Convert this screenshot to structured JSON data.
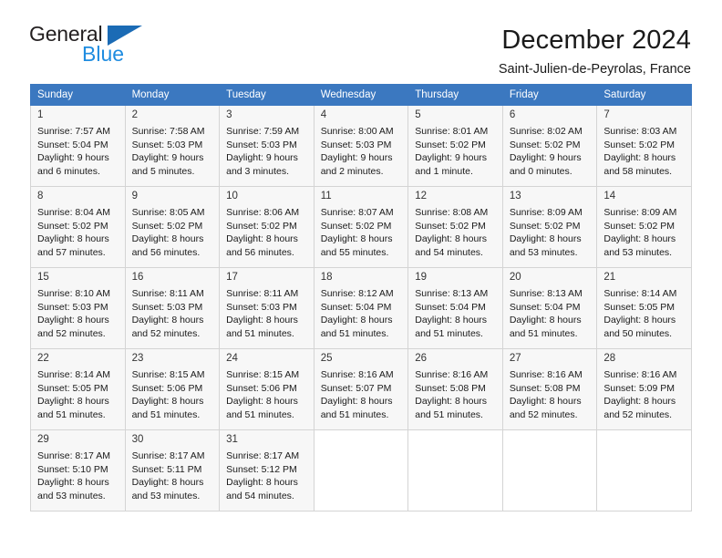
{
  "brand": {
    "name_top": "General",
    "name_bottom": "Blue",
    "accent_color": "#1f8ce0",
    "triangle_color": "#1b6bb5"
  },
  "header": {
    "title": "December 2024",
    "subtitle": "Saint-Julien-de-Peyrolas, France"
  },
  "calendar": {
    "header_bg": "#3b78c0",
    "weekdays": [
      "Sunday",
      "Monday",
      "Tuesday",
      "Wednesday",
      "Thursday",
      "Friday",
      "Saturday"
    ],
    "weeks": [
      [
        {
          "day": "1",
          "sunrise": "Sunrise: 7:57 AM",
          "sunset": "Sunset: 5:04 PM",
          "daylight1": "Daylight: 9 hours",
          "daylight2": "and 6 minutes."
        },
        {
          "day": "2",
          "sunrise": "Sunrise: 7:58 AM",
          "sunset": "Sunset: 5:03 PM",
          "daylight1": "Daylight: 9 hours",
          "daylight2": "and 5 minutes."
        },
        {
          "day": "3",
          "sunrise": "Sunrise: 7:59 AM",
          "sunset": "Sunset: 5:03 PM",
          "daylight1": "Daylight: 9 hours",
          "daylight2": "and 3 minutes."
        },
        {
          "day": "4",
          "sunrise": "Sunrise: 8:00 AM",
          "sunset": "Sunset: 5:03 PM",
          "daylight1": "Daylight: 9 hours",
          "daylight2": "and 2 minutes."
        },
        {
          "day": "5",
          "sunrise": "Sunrise: 8:01 AM",
          "sunset": "Sunset: 5:02 PM",
          "daylight1": "Daylight: 9 hours",
          "daylight2": "and 1 minute."
        },
        {
          "day": "6",
          "sunrise": "Sunrise: 8:02 AM",
          "sunset": "Sunset: 5:02 PM",
          "daylight1": "Daylight: 9 hours",
          "daylight2": "and 0 minutes."
        },
        {
          "day": "7",
          "sunrise": "Sunrise: 8:03 AM",
          "sunset": "Sunset: 5:02 PM",
          "daylight1": "Daylight: 8 hours",
          "daylight2": "and 58 minutes."
        }
      ],
      [
        {
          "day": "8",
          "sunrise": "Sunrise: 8:04 AM",
          "sunset": "Sunset: 5:02 PM",
          "daylight1": "Daylight: 8 hours",
          "daylight2": "and 57 minutes."
        },
        {
          "day": "9",
          "sunrise": "Sunrise: 8:05 AM",
          "sunset": "Sunset: 5:02 PM",
          "daylight1": "Daylight: 8 hours",
          "daylight2": "and 56 minutes."
        },
        {
          "day": "10",
          "sunrise": "Sunrise: 8:06 AM",
          "sunset": "Sunset: 5:02 PM",
          "daylight1": "Daylight: 8 hours",
          "daylight2": "and 56 minutes."
        },
        {
          "day": "11",
          "sunrise": "Sunrise: 8:07 AM",
          "sunset": "Sunset: 5:02 PM",
          "daylight1": "Daylight: 8 hours",
          "daylight2": "and 55 minutes."
        },
        {
          "day": "12",
          "sunrise": "Sunrise: 8:08 AM",
          "sunset": "Sunset: 5:02 PM",
          "daylight1": "Daylight: 8 hours",
          "daylight2": "and 54 minutes."
        },
        {
          "day": "13",
          "sunrise": "Sunrise: 8:09 AM",
          "sunset": "Sunset: 5:02 PM",
          "daylight1": "Daylight: 8 hours",
          "daylight2": "and 53 minutes."
        },
        {
          "day": "14",
          "sunrise": "Sunrise: 8:09 AM",
          "sunset": "Sunset: 5:02 PM",
          "daylight1": "Daylight: 8 hours",
          "daylight2": "and 53 minutes."
        }
      ],
      [
        {
          "day": "15",
          "sunrise": "Sunrise: 8:10 AM",
          "sunset": "Sunset: 5:03 PM",
          "daylight1": "Daylight: 8 hours",
          "daylight2": "and 52 minutes."
        },
        {
          "day": "16",
          "sunrise": "Sunrise: 8:11 AM",
          "sunset": "Sunset: 5:03 PM",
          "daylight1": "Daylight: 8 hours",
          "daylight2": "and 52 minutes."
        },
        {
          "day": "17",
          "sunrise": "Sunrise: 8:11 AM",
          "sunset": "Sunset: 5:03 PM",
          "daylight1": "Daylight: 8 hours",
          "daylight2": "and 51 minutes."
        },
        {
          "day": "18",
          "sunrise": "Sunrise: 8:12 AM",
          "sunset": "Sunset: 5:04 PM",
          "daylight1": "Daylight: 8 hours",
          "daylight2": "and 51 minutes."
        },
        {
          "day": "19",
          "sunrise": "Sunrise: 8:13 AM",
          "sunset": "Sunset: 5:04 PM",
          "daylight1": "Daylight: 8 hours",
          "daylight2": "and 51 minutes."
        },
        {
          "day": "20",
          "sunrise": "Sunrise: 8:13 AM",
          "sunset": "Sunset: 5:04 PM",
          "daylight1": "Daylight: 8 hours",
          "daylight2": "and 51 minutes."
        },
        {
          "day": "21",
          "sunrise": "Sunrise: 8:14 AM",
          "sunset": "Sunset: 5:05 PM",
          "daylight1": "Daylight: 8 hours",
          "daylight2": "and 50 minutes."
        }
      ],
      [
        {
          "day": "22",
          "sunrise": "Sunrise: 8:14 AM",
          "sunset": "Sunset: 5:05 PM",
          "daylight1": "Daylight: 8 hours",
          "daylight2": "and 51 minutes."
        },
        {
          "day": "23",
          "sunrise": "Sunrise: 8:15 AM",
          "sunset": "Sunset: 5:06 PM",
          "daylight1": "Daylight: 8 hours",
          "daylight2": "and 51 minutes."
        },
        {
          "day": "24",
          "sunrise": "Sunrise: 8:15 AM",
          "sunset": "Sunset: 5:06 PM",
          "daylight1": "Daylight: 8 hours",
          "daylight2": "and 51 minutes."
        },
        {
          "day": "25",
          "sunrise": "Sunrise: 8:16 AM",
          "sunset": "Sunset: 5:07 PM",
          "daylight1": "Daylight: 8 hours",
          "daylight2": "and 51 minutes."
        },
        {
          "day": "26",
          "sunrise": "Sunrise: 8:16 AM",
          "sunset": "Sunset: 5:08 PM",
          "daylight1": "Daylight: 8 hours",
          "daylight2": "and 51 minutes."
        },
        {
          "day": "27",
          "sunrise": "Sunrise: 8:16 AM",
          "sunset": "Sunset: 5:08 PM",
          "daylight1": "Daylight: 8 hours",
          "daylight2": "and 52 minutes."
        },
        {
          "day": "28",
          "sunrise": "Sunrise: 8:16 AM",
          "sunset": "Sunset: 5:09 PM",
          "daylight1": "Daylight: 8 hours",
          "daylight2": "and 52 minutes."
        }
      ],
      [
        {
          "day": "29",
          "sunrise": "Sunrise: 8:17 AM",
          "sunset": "Sunset: 5:10 PM",
          "daylight1": "Daylight: 8 hours",
          "daylight2": "and 53 minutes."
        },
        {
          "day": "30",
          "sunrise": "Sunrise: 8:17 AM",
          "sunset": "Sunset: 5:11 PM",
          "daylight1": "Daylight: 8 hours",
          "daylight2": "and 53 minutes."
        },
        {
          "day": "31",
          "sunrise": "Sunrise: 8:17 AM",
          "sunset": "Sunset: 5:12 PM",
          "daylight1": "Daylight: 8 hours",
          "daylight2": "and 54 minutes."
        },
        null,
        null,
        null,
        null
      ]
    ]
  }
}
